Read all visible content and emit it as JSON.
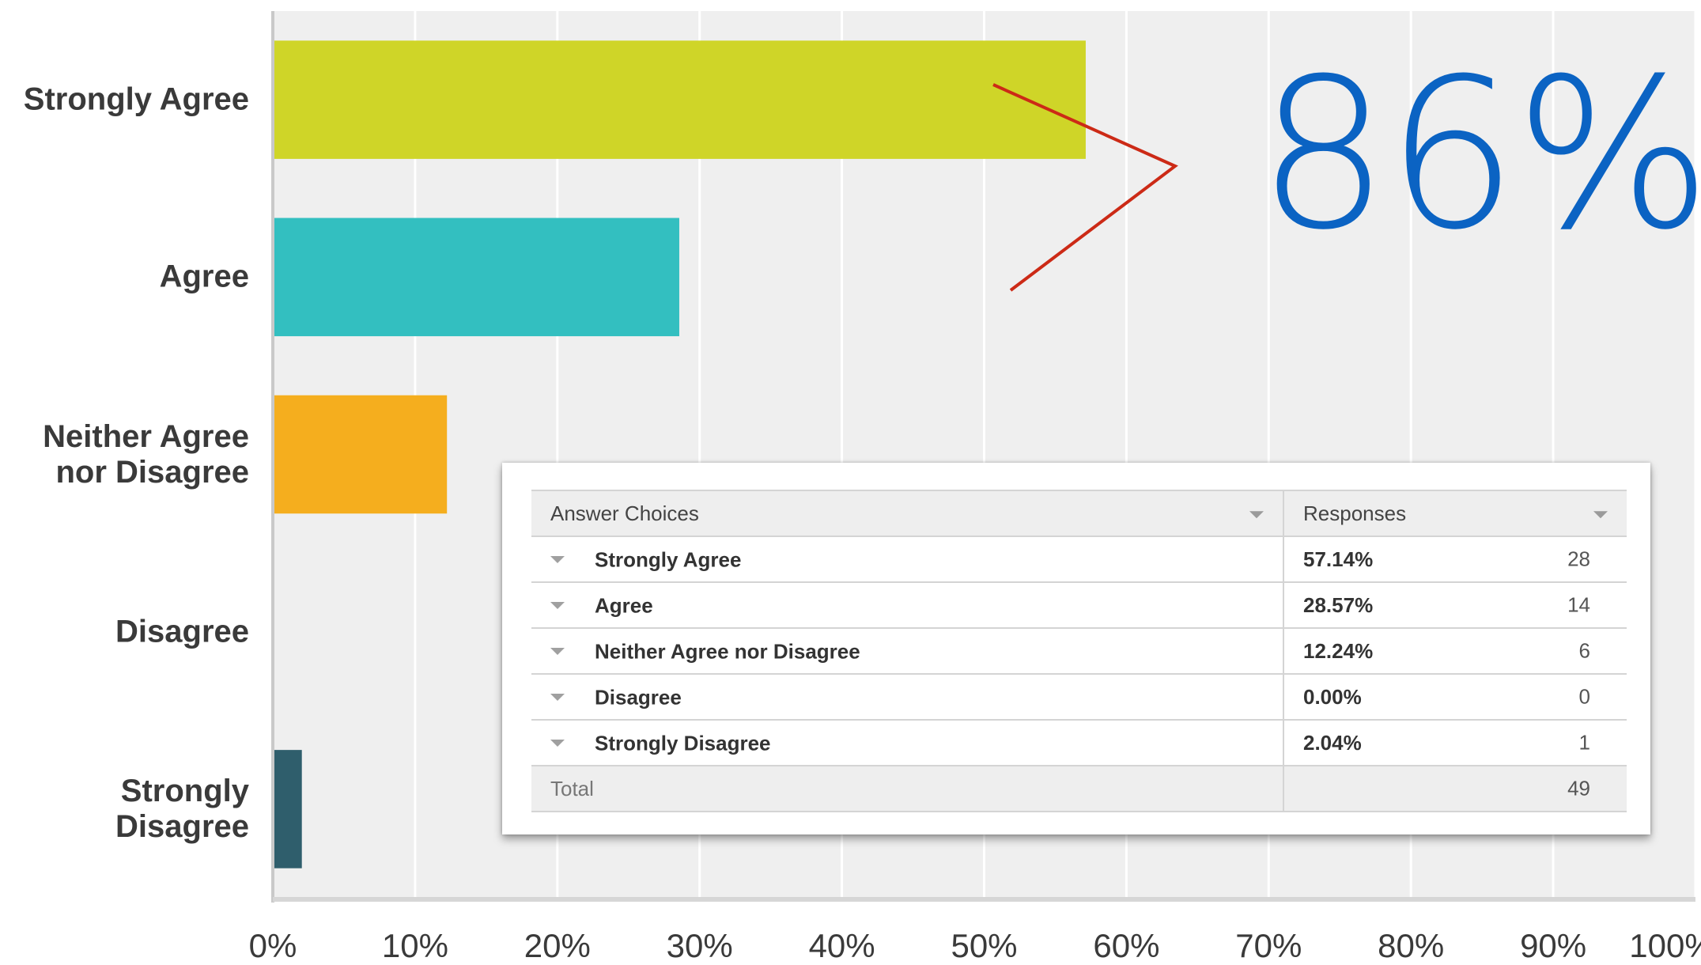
{
  "chart_data": {
    "type": "bar",
    "orientation": "horizontal",
    "categories": [
      "Strongly Agree",
      "Agree",
      "Neither Agree\nnor Disagree",
      "Disagree",
      "Strongly\nDisagree"
    ],
    "values": [
      57.14,
      28.57,
      12.24,
      0.0,
      2.04
    ],
    "colors": [
      "#cfd528",
      "#33bfc0",
      "#f5ae1e",
      "#8a8a8a",
      "#2f5e6c"
    ],
    "xlim": [
      0,
      100
    ],
    "x_ticks": [
      "0%",
      "10%",
      "20%",
      "30%",
      "40%",
      "50%",
      "60%",
      "70%",
      "80%",
      "90%",
      "100%"
    ],
    "grid": true,
    "background": "#efefef"
  },
  "callout": {
    "text": "86%",
    "color": "#0b63c3",
    "arrow_color": "#cc2a16"
  },
  "table": {
    "header_choices": "Answer Choices",
    "header_responses": "Responses",
    "rows": [
      {
        "choice": "Strongly Agree",
        "percent": "57.14%",
        "count": "28"
      },
      {
        "choice": "Agree",
        "percent": "28.57%",
        "count": "14"
      },
      {
        "choice": "Neither Agree nor Disagree",
        "percent": "12.24%",
        "count": "6"
      },
      {
        "choice": "Disagree",
        "percent": "0.00%",
        "count": "0"
      },
      {
        "choice": "Strongly Disagree",
        "percent": "2.04%",
        "count": "1"
      }
    ],
    "total_label": "Total",
    "total_count": "49"
  }
}
